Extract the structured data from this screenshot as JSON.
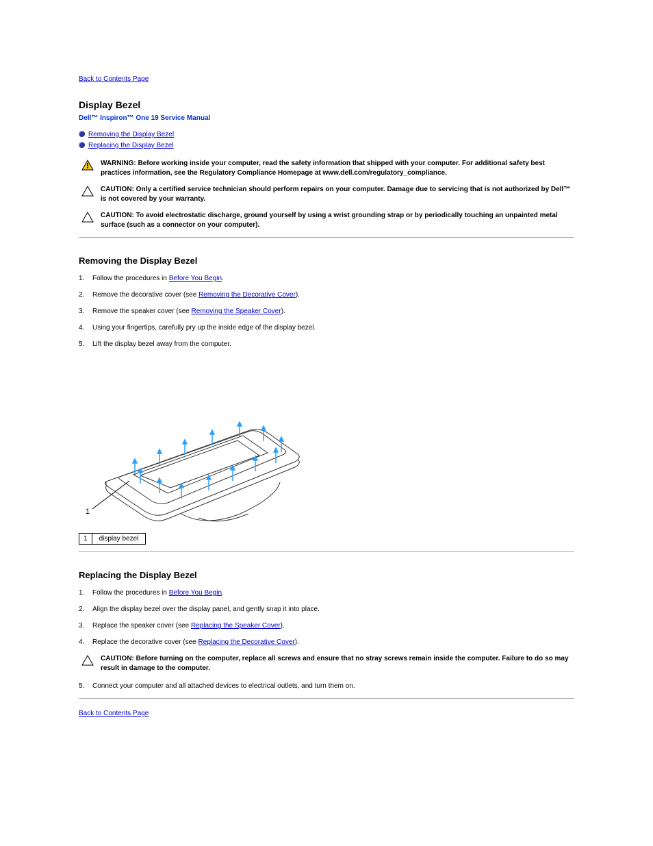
{
  "nav": {
    "back_to_contents": "Back to Contents Page"
  },
  "page_title": "Display Bezel",
  "manual_line": "Dell™ Inspiron™ One 19 Service Manual",
  "toc": {
    "remove": "Removing the Display Bezel",
    "replace": "Replacing the Display Bezel"
  },
  "warning": {
    "label": "WARNING:",
    "text": "Before working inside your computer, read the safety information that shipped with your computer. For additional safety best practices information, see the Regulatory Compliance Homepage at www.dell.com/regulatory_compliance."
  },
  "caution1": {
    "label": "CAUTION:",
    "text_lead": "Only a certified service technician should perform repairs on your computer. Damage due to servicing that is not authorized by Dell™",
    "text_tail": "is not covered by your warranty."
  },
  "caution2": {
    "label": "CAUTION:",
    "text": "To avoid electrostatic discharge, ground yourself by using a wrist grounding strap or by periodically touching an unpainted metal surface (such as a connector on your computer)."
  },
  "remove": {
    "heading": "Removing the Display Bezel",
    "steps": {
      "s1_a": "Follow the procedures in ",
      "s1_link": "Before You Begin",
      "s1_b": ".",
      "s2_a": "Remove the decorative cover (see ",
      "s2_link": "Removing the Decorative Cover",
      "s2_b": ").",
      "s3_a": "Remove the speaker cover (see ",
      "s3_link": "Removing the Speaker Cover",
      "s3_b": ").",
      "s4": "Using your fingertips, carefully pry up the inside edge of the display bezel.",
      "s5": "Lift the display bezel away from the computer."
    }
  },
  "callout": {
    "num": "1",
    "label": "display bezel"
  },
  "replace": {
    "heading": "Replacing the Display Bezel",
    "steps": {
      "s1_a": "Follow the procedures in ",
      "s1_link": "Before You Begin",
      "s1_b": ".",
      "s2": "Align the display bezel over the display panel, and gently snap it into place.",
      "s3_a": "Replace the speaker cover (see ",
      "s3_link": "Replacing the Speaker Cover",
      "s3_b": ").",
      "s4_a": "Replace the decorative cover (see ",
      "s4_link": "Replacing the Decorative Cover",
      "s4_b": ")."
    }
  },
  "caution3": {
    "label": "CAUTION:",
    "text": "Before turning on the computer, replace all screws and ensure that no stray screws remain inside the computer. Failure to do so may result in damage to the computer."
  },
  "replace_final_step": "Connect your computer and all attached devices to electrical outlets, and turn them on."
}
